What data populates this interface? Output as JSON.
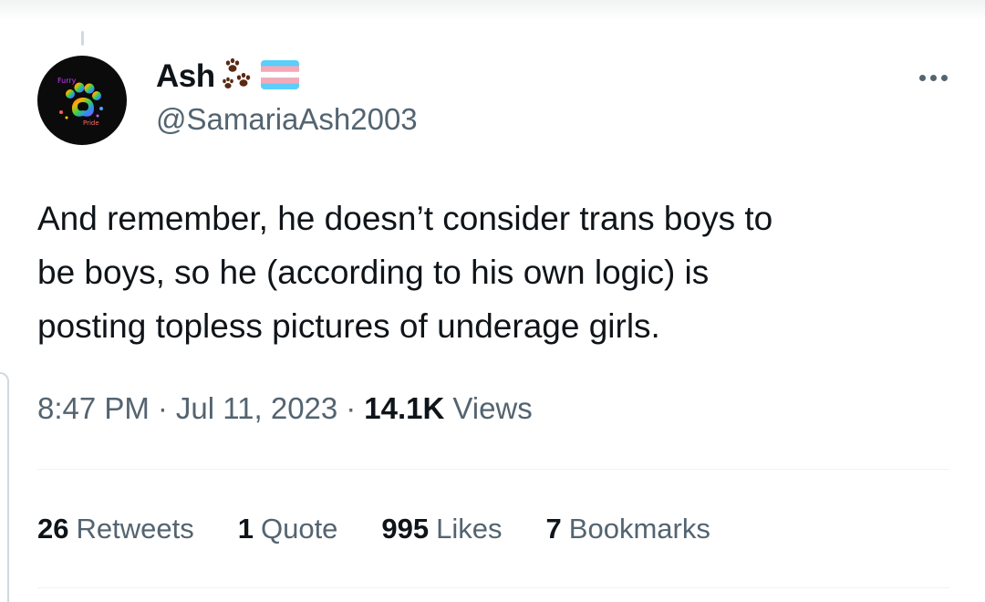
{
  "author": {
    "display_name": "Ash",
    "handle": "@SamariaAsh2003",
    "avatar": {
      "top_text": "Furry",
      "bottom_text": "Pride",
      "icon": "rainbow-paw-icon"
    },
    "emoji": [
      "paw-prints-icon",
      "transgender-flag-icon"
    ]
  },
  "tweet": {
    "text_lines": [
      "And remember, he doesn’t consider trans boys to",
      "be boys, so he (according to his own logic) is",
      "posting topless pictures of underage girls."
    ],
    "time": "8:47 PM",
    "date": "Jul 11, 2023",
    "separator": "·",
    "views_count": "14.1K",
    "views_label": "Views"
  },
  "stats": {
    "retweets": {
      "count": "26",
      "label": "Retweets"
    },
    "quotes": {
      "count": "1",
      "label": "Quote"
    },
    "likes": {
      "count": "995",
      "label": "Likes"
    },
    "bookmarks": {
      "count": "7",
      "label": "Bookmarks"
    }
  },
  "colors": {
    "text_primary": "#0f1419",
    "text_secondary": "#536471",
    "divider": "#eff3f4",
    "paw_brown": "#5a2a14",
    "trans_blue": "#5bcefa",
    "trans_pink": "#f5a9b8"
  },
  "icons": {
    "more": "more-horizontal-icon"
  }
}
